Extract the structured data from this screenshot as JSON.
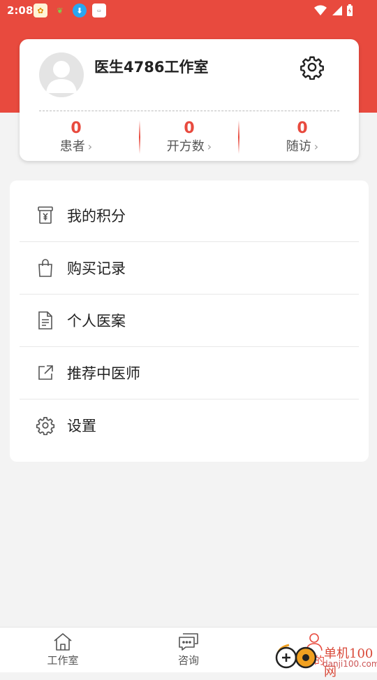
{
  "status_bar": {
    "time": "2:08",
    "colors": {
      "background": "#e84a3e",
      "text": "#ffffff"
    },
    "app_icons": [
      "app-icon-1",
      "app-icon-2",
      "download-icon",
      "app-icon-4"
    ],
    "system_icons": [
      "wifi-icon",
      "signal-icon",
      "battery-icon"
    ]
  },
  "profile": {
    "name": "医生4786工作室",
    "stats": [
      {
        "value": "0",
        "label": "患者"
      },
      {
        "value": "0",
        "label": "开方数"
      },
      {
        "value": "0",
        "label": "随访"
      }
    ]
  },
  "menu": {
    "items": [
      {
        "label": "我的积分",
        "icon": "points-icon"
      },
      {
        "label": "购买记录",
        "icon": "shopping-bag-icon"
      },
      {
        "label": "个人医案",
        "icon": "document-icon"
      },
      {
        "label": "推荐中医师",
        "icon": "share-icon"
      },
      {
        "label": "设置",
        "icon": "gear-icon"
      }
    ]
  },
  "tabbar": {
    "tabs": [
      {
        "label": "工作室",
        "icon": "home-icon"
      },
      {
        "label": "咨询",
        "icon": "chat-icon"
      },
      {
        "label": "我的",
        "icon": "user-icon"
      }
    ]
  },
  "watermark": {
    "title": "单机100网",
    "url": "danji100.com"
  },
  "theme": {
    "accent": "#e84a3e",
    "page_background": "#f3f3f3"
  }
}
